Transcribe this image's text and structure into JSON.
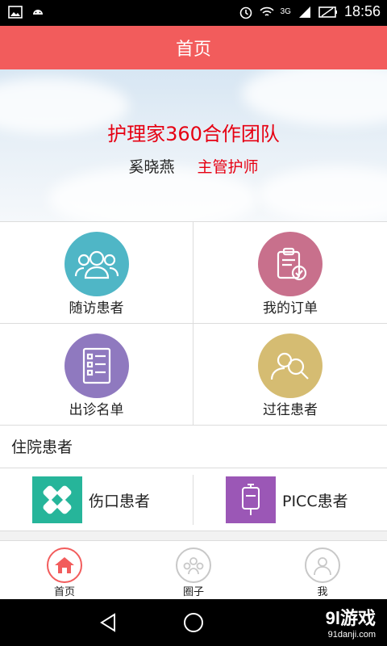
{
  "status_bar": {
    "time": "18:56",
    "net": "3G",
    "left_icons": [
      "image-icon",
      "android-icon"
    ],
    "right_icons": [
      "alarm-icon",
      "wifi-icon",
      "signal-icon",
      "battery-icon"
    ]
  },
  "header": {
    "title": "首页"
  },
  "banner": {
    "title": "护理家360合作团队",
    "name": "奚晓燕",
    "role": "主管护师"
  },
  "grid": [
    {
      "label": "随访患者",
      "icon": "people-icon",
      "color": "#4fb6c6"
    },
    {
      "label": "我的订单",
      "icon": "order-icon",
      "color": "#c8708c"
    },
    {
      "label": "出诊名单",
      "icon": "checklist-icon",
      "color": "#8f79bf"
    },
    {
      "label": "过往患者",
      "icon": "search-person-icon",
      "color": "#d5bc72"
    }
  ],
  "section": {
    "title": "住院患者"
  },
  "inpatient": [
    {
      "label": "伤口患者",
      "icon": "bandage-icon",
      "color": "#26b59a"
    },
    {
      "label": "PICC患者",
      "icon": "iv-bag-icon",
      "color": "#9b57b6"
    }
  ],
  "tabs": [
    {
      "label": "首页",
      "icon": "home-icon",
      "active": true
    },
    {
      "label": "圈子",
      "icon": "circle-icon",
      "active": false
    },
    {
      "label": "我",
      "icon": "person-icon",
      "active": false
    }
  ],
  "nav": {
    "icons": [
      "back-icon",
      "home-nav-icon"
    ]
  },
  "watermark": {
    "main": "9l游戏",
    "sub": "91danji.com"
  },
  "colors": {
    "accent": "#f25c5c",
    "banner_red": "#e60012"
  }
}
